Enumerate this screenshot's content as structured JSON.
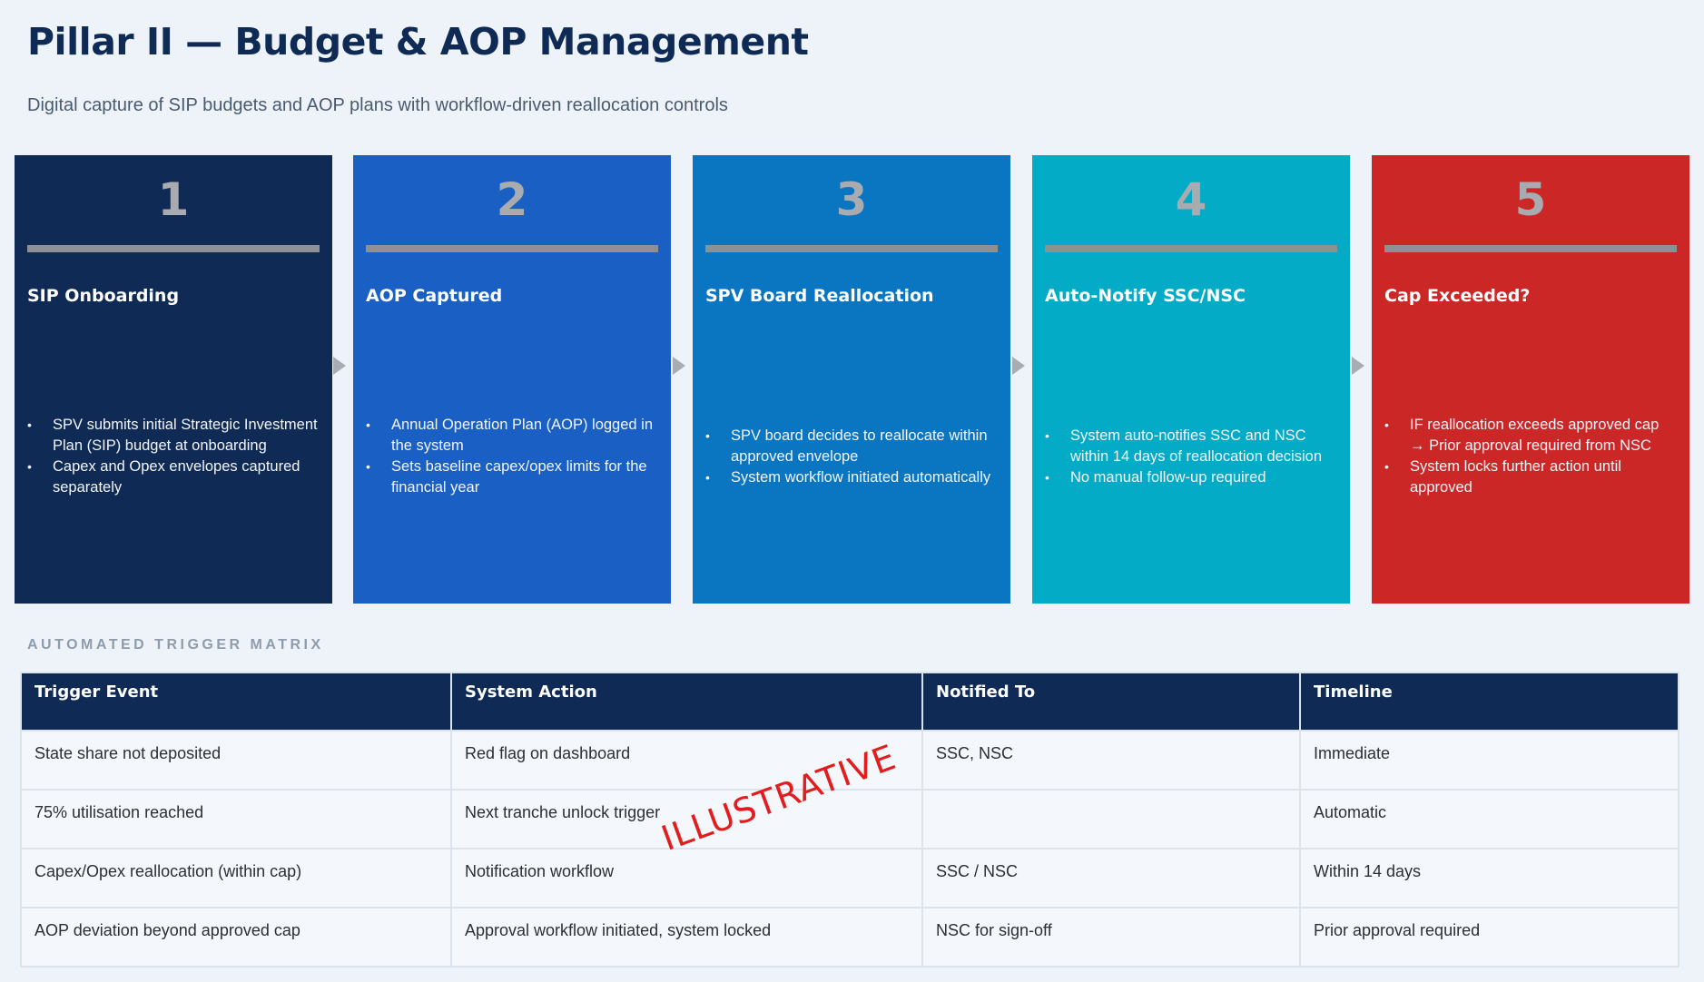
{
  "header": {
    "title": "Pillar II — Budget & AOP Management",
    "subtitle": "Digital capture of SIP budgets and AOP plans with workflow-driven reallocation controls"
  },
  "steps": [
    {
      "number": "1",
      "title": "SIP Onboarding",
      "color": "#0f2a55",
      "bullets": [
        "SPV submits initial Strategic Investment Plan (SIP) budget at onboarding",
        "Capex and Opex envelopes captured separately"
      ]
    },
    {
      "number": "2",
      "title": "AOP Captured",
      "color": "#1a5fc4",
      "bullets": [
        "Annual Operation Plan (AOP) logged in the system",
        "Sets baseline capex/opex limits for the financial year"
      ]
    },
    {
      "number": "3",
      "title": "SPV Board Reallocation",
      "color": "#0a75c0",
      "bullets": [
        "SPV board decides to reallocate within approved envelope",
        "System workflow initiated automatically"
      ]
    },
    {
      "number": "4",
      "title": "Auto-Notify SSC/NSC",
      "color": "#03abc6",
      "bullets": [
        "System auto-notifies SSC and NSC within 14 days of reallocation decision",
        "No manual follow-up required"
      ]
    },
    {
      "number": "5",
      "title": "Cap Exceeded?",
      "color": "#cc2727",
      "bullets": [
        "IF reallocation exceeds approved cap → Prior approval required from NSC",
        "System locks further action until approved"
      ]
    }
  ],
  "matrix": {
    "label": "AUTOMATED TRIGGER MATRIX",
    "headers": [
      "Trigger Event",
      "System Action",
      "Notified To",
      "Timeline"
    ],
    "rows": [
      [
        "State share not deposited",
        "Red flag on dashboard",
        "SSC, NSC",
        "Immediate"
      ],
      [
        "75% utilisation reached",
        "Next tranche unlock trigger",
        "",
        "Automatic"
      ],
      [
        "Capex/Opex reallocation (within cap)",
        "Notification workflow",
        "SSC / NSC",
        "Within 14 days"
      ],
      [
        "AOP deviation beyond approved cap",
        "Approval workflow initiated, system locked",
        "NSC for sign-off",
        "Prior approval required"
      ]
    ]
  },
  "watermark": "ILLUSTRATIVE"
}
